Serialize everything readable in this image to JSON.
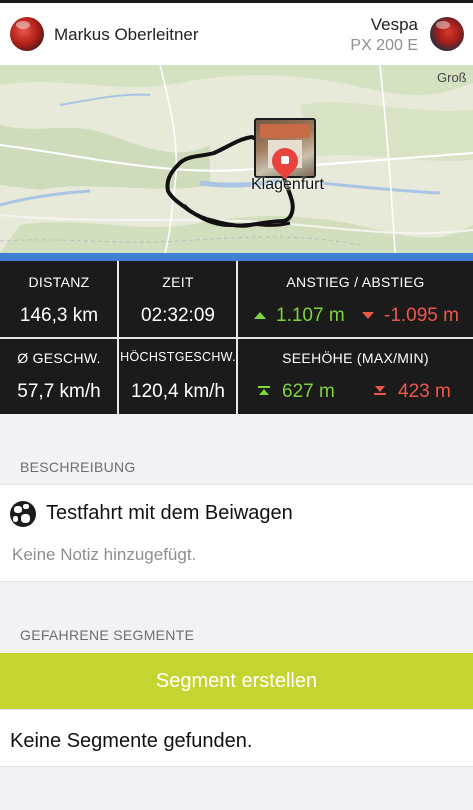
{
  "header": {
    "user_name": "Markus Oberleitner",
    "bike_name": "Vespa",
    "bike_model": "PX 200 E"
  },
  "map": {
    "city_label": "Klagenfurt",
    "corner_label": "Groß",
    "route_color": "#111111",
    "marker_color": "#e8443d"
  },
  "stats": {
    "distance": {
      "label": "DISTANZ",
      "value": "146,3 km"
    },
    "time": {
      "label": "ZEIT",
      "value": "02:32:09"
    },
    "climb": {
      "label": "ANSTIEG / ABSTIEG",
      "ascent": "1.107 m",
      "descent": "-1.095 m"
    },
    "avg_speed": {
      "label": "Ø GESCHW.",
      "value": "57,7 km/h"
    },
    "max_speed": {
      "label": "HÖCHSTGESCHW.",
      "value": "120,4 km/h"
    },
    "altitude": {
      "label": "SEEHÖHE (MAX/MIN)",
      "max": "627 m",
      "min": "423 m"
    }
  },
  "description": {
    "section_title": "BESCHREIBUNG",
    "title": "Testfahrt mit dem Beiwagen",
    "note": "Keine Notiz hinzugefügt."
  },
  "segments": {
    "section_title": "GEFAHRENE SEGMENTE",
    "create_button": "Segment erstellen",
    "empty_text": "Keine Segmente gefunden."
  },
  "colors": {
    "accent_green": "#c4d531",
    "ascent_green": "#7fd43a",
    "descent_red": "#f0574b",
    "stats_bg": "#1b1b1b"
  }
}
